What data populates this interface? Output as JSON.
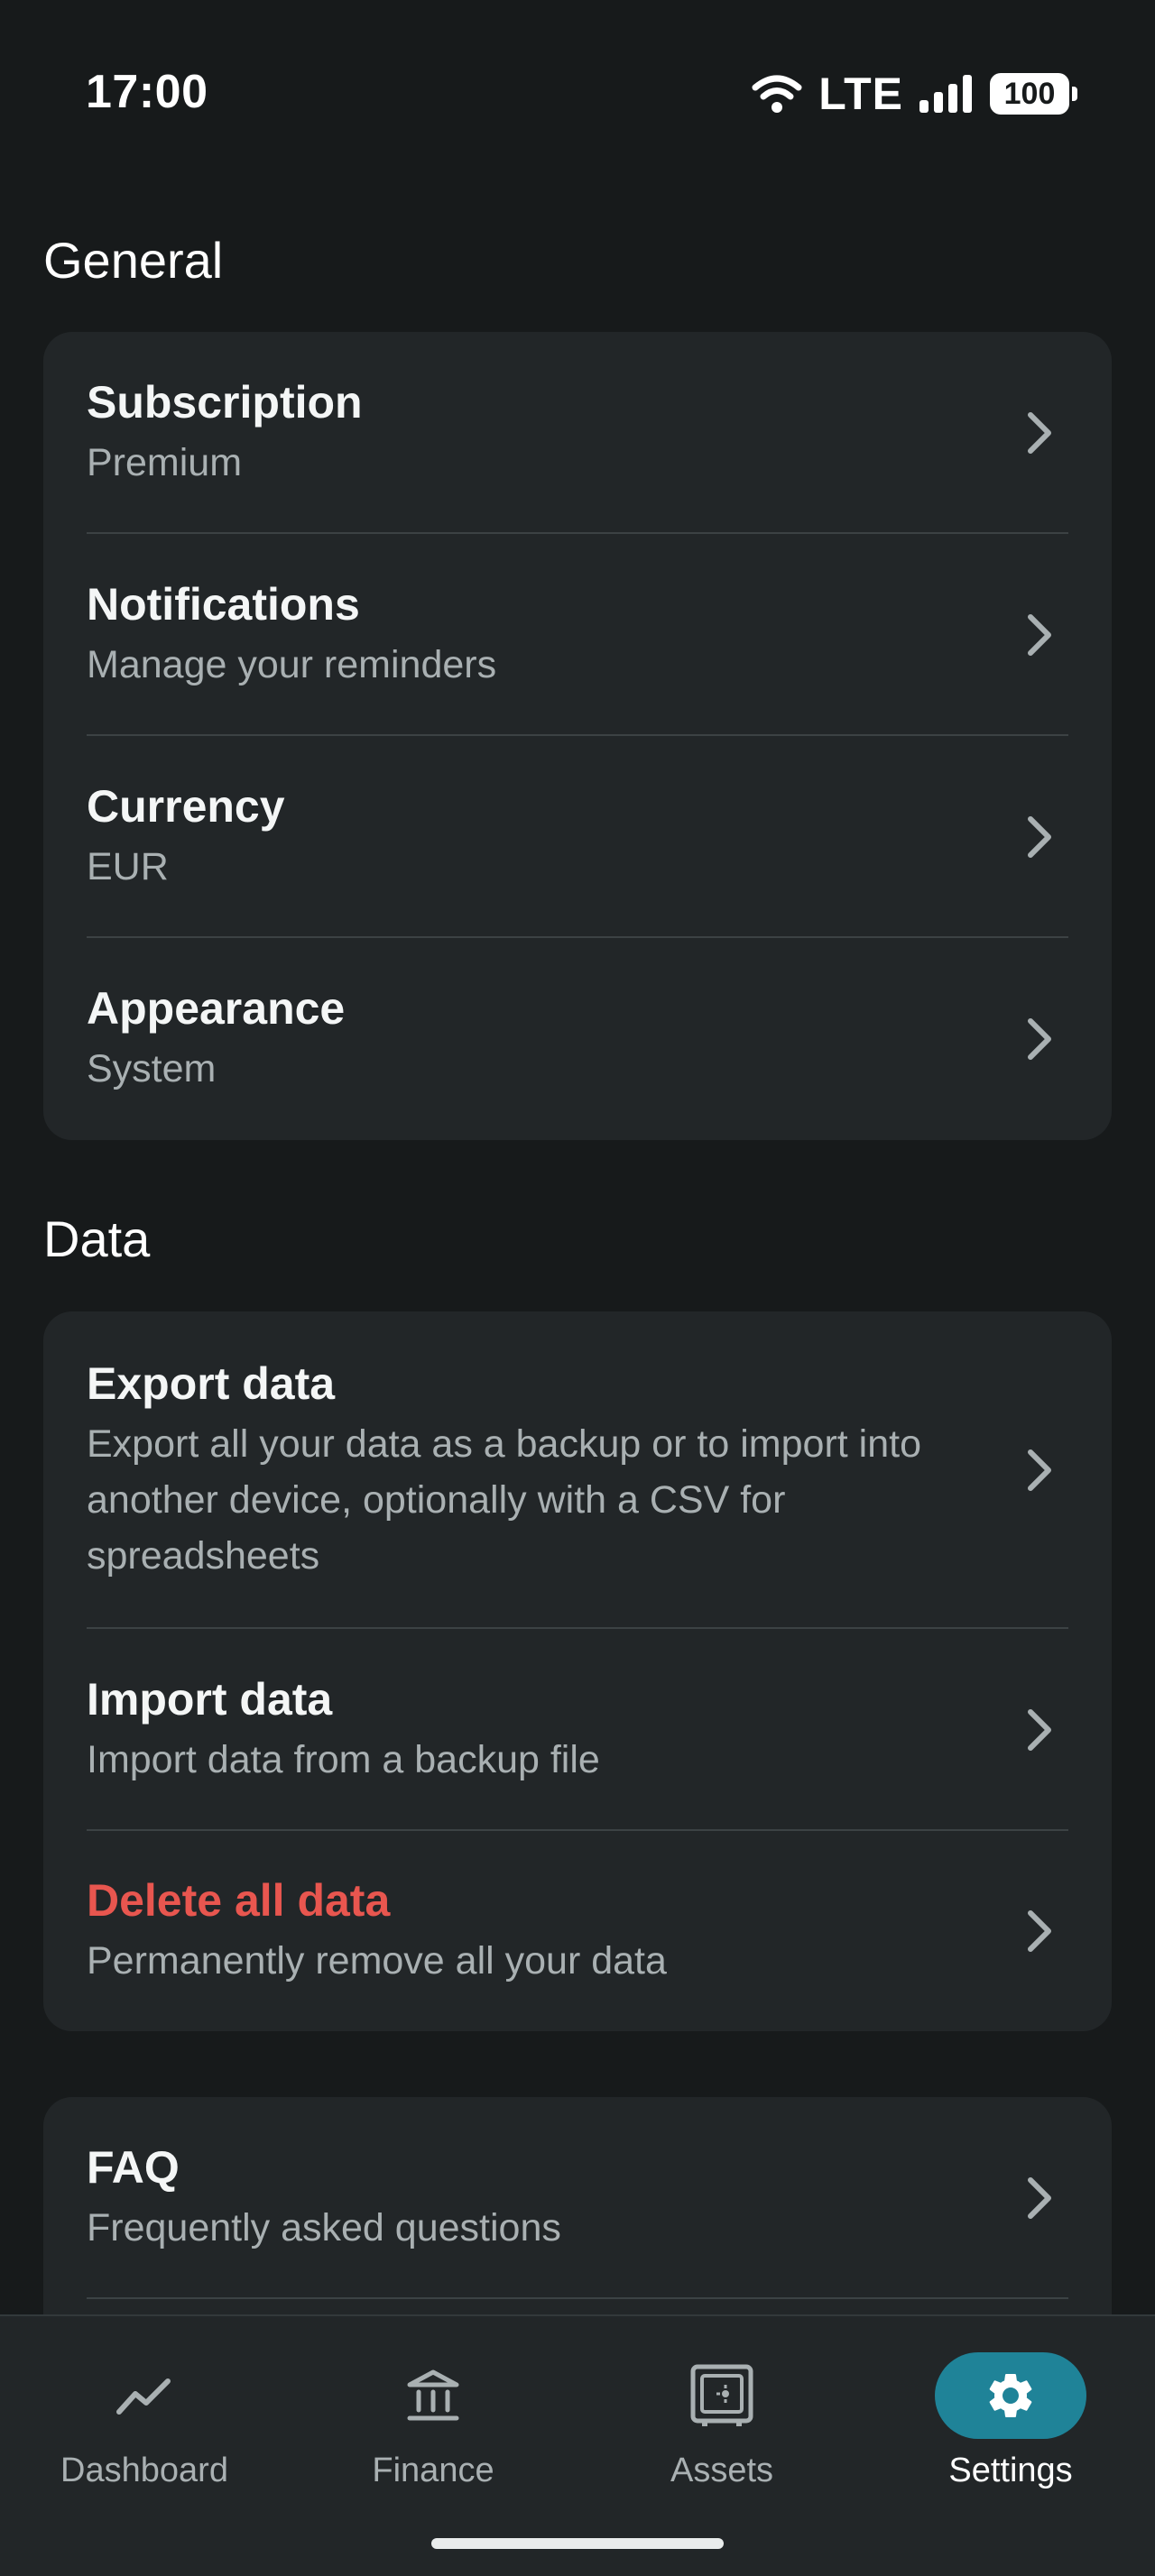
{
  "status_bar": {
    "time": "17:00",
    "network": "LTE",
    "battery": "100"
  },
  "sections": {
    "general": {
      "title": "General",
      "items": [
        {
          "title": "Subscription",
          "subtitle": "Premium"
        },
        {
          "title": "Notifications",
          "subtitle": "Manage your reminders"
        },
        {
          "title": "Currency",
          "subtitle": "EUR"
        },
        {
          "title": "Appearance",
          "subtitle": "System"
        }
      ]
    },
    "data": {
      "title": "Data",
      "items": [
        {
          "title": "Export data",
          "subtitle": "Export all your data as a backup or to import into another device, optionally with a CSV for spreadsheets"
        },
        {
          "title": "Import data",
          "subtitle": "Import data from a backup file"
        },
        {
          "title": "Delete all data",
          "subtitle": "Permanently remove all your data",
          "color": "#e8564f"
        }
      ]
    },
    "help": {
      "items": [
        {
          "title": "FAQ",
          "subtitle": "Frequently asked questions"
        }
      ]
    }
  },
  "nav": {
    "items": [
      {
        "label": "Dashboard",
        "icon": "trending-line-icon"
      },
      {
        "label": "Finance",
        "icon": "bank-icon"
      },
      {
        "label": "Assets",
        "icon": "safe-icon"
      },
      {
        "label": "Settings",
        "icon": "gear-icon",
        "active": true
      }
    ],
    "accent": "#1f8398"
  }
}
